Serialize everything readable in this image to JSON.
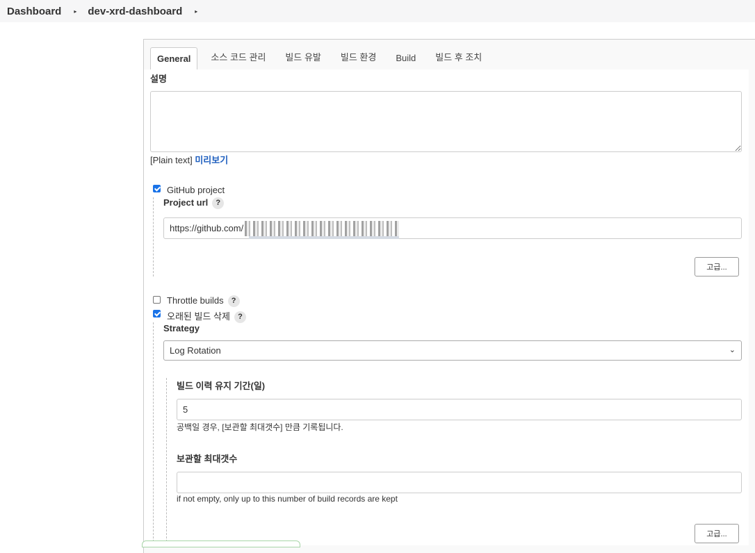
{
  "breadcrumb": {
    "items": [
      "Dashboard",
      "dev-xrd-dashboard"
    ]
  },
  "tabs": [
    "General",
    "소스 코드 관리",
    "빌드 유발",
    "빌드 환경",
    "Build",
    "빌드 후 조치"
  ],
  "general": {
    "description_label": "설명",
    "description_value": "",
    "plain_text": "[Plain text]",
    "preview_link": "미리보기",
    "github_project": {
      "label": "GitHub project",
      "checked": true,
      "project_url_label": "Project url",
      "project_url_value": "https://github.com/",
      "advanced_button": "고급..."
    },
    "throttle_builds": {
      "label": "Throttle builds",
      "checked": false
    },
    "discard_old_builds": {
      "label": "오래된 빌드 삭제",
      "checked": true,
      "strategy_label": "Strategy",
      "strategy_value": "Log Rotation",
      "days_label": "빌드 이력 유지 기간(일)",
      "days_value": "5",
      "days_hint": "공백일 경우, [보관할 최대갯수] 만큼 기록됩니다.",
      "max_label": "보관할 최대갯수",
      "max_value": "",
      "max_hint": "if not empty, only up to this number of build records are kept",
      "advanced_button": "고급..."
    }
  },
  "help_glyph": "?",
  "icons": {
    "breadcrumb_separator": "▸",
    "select_chevron": "⌄"
  }
}
